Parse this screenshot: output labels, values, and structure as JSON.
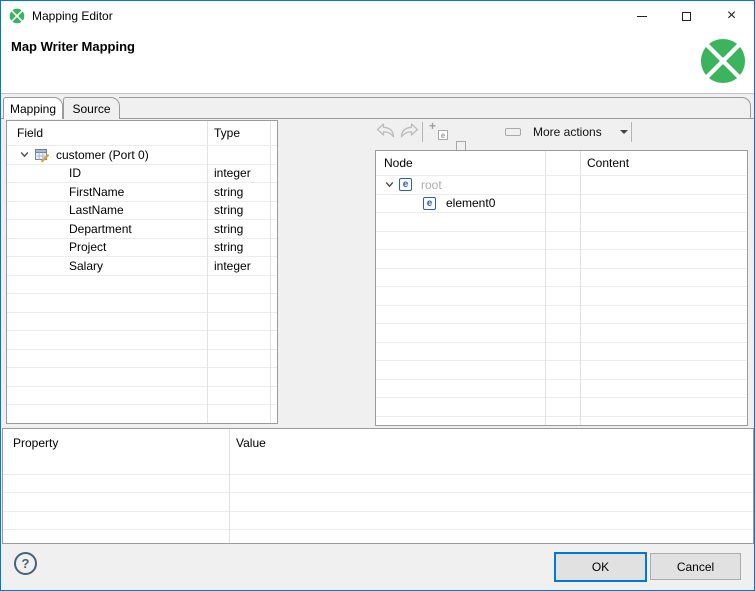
{
  "window": {
    "title": "Mapping Editor"
  },
  "header": {
    "title": "Map Writer Mapping"
  },
  "tabs": [
    {
      "label": "Mapping",
      "active": true
    },
    {
      "label": "Source",
      "active": false
    }
  ],
  "toolbar": {
    "more_actions_label": "More actions",
    "buttons": [
      {
        "name": "undo",
        "enabled": false
      },
      {
        "name": "redo",
        "enabled": false
      },
      {
        "name": "add-child-element",
        "enabled": false
      },
      {
        "name": "add-element",
        "enabled": false
      },
      {
        "name": "add-wildcard-element",
        "enabled": false
      },
      {
        "name": "add-text-node",
        "enabled": false
      },
      {
        "name": "more-actions",
        "enabled": true
      },
      {
        "name": "expand-all",
        "enabled": true
      },
      {
        "name": "collapse-all",
        "enabled": true
      }
    ]
  },
  "field_table": {
    "columns": [
      "Field",
      "Type"
    ],
    "root": {
      "label": "customer (Port 0)",
      "expanded": true
    },
    "rows": [
      {
        "field": "ID",
        "type": "integer"
      },
      {
        "field": "FirstName",
        "type": "string"
      },
      {
        "field": "LastName",
        "type": "string"
      },
      {
        "field": "Department",
        "type": "string"
      },
      {
        "field": "Project",
        "type": "string"
      },
      {
        "field": "Salary",
        "type": "integer"
      }
    ],
    "empty_rows": 8
  },
  "node_table": {
    "columns": [
      "Node",
      "Content"
    ],
    "rows": [
      {
        "label": "root",
        "level": 0,
        "expanded": true,
        "grayed": true
      },
      {
        "label": "element0",
        "level": 1,
        "expanded": false,
        "grayed": false
      }
    ],
    "empty_rows": 11
  },
  "property_table": {
    "columns": [
      "Property",
      "Value"
    ],
    "rows": [],
    "empty_rows": 5
  },
  "footer": {
    "help_label": "?",
    "ok_label": "OK",
    "cancel_label": "Cancel"
  },
  "icons": {
    "element_letter": "e",
    "plus": "+",
    "minus": "−",
    "question": "?",
    "close": "×"
  },
  "colors": {
    "accent": "#0078d7",
    "clover_green": "#3cb45e",
    "element_blue": "#2b5fb2",
    "panel_background": "#f0f0f0"
  }
}
